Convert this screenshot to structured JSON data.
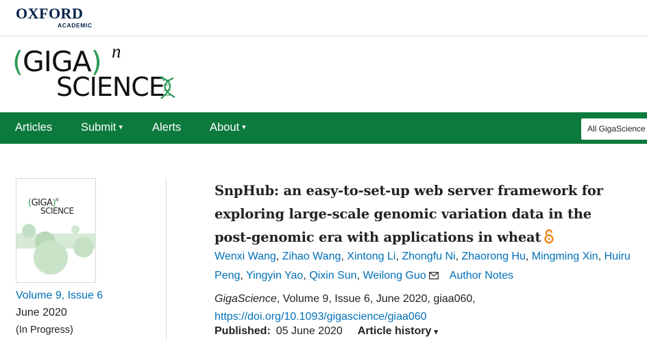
{
  "publisher": {
    "name": "OXFORD",
    "sub": "ACADEMIC"
  },
  "journal_logo": {
    "open_paren": "(",
    "giga": "GIGA",
    "close_paren": ")",
    "sup": "n",
    "science": "SCIENCE"
  },
  "nav": {
    "items": [
      {
        "label": "Articles",
        "has_caret": false
      },
      {
        "label": "Submit",
        "has_caret": true
      },
      {
        "label": "Alerts",
        "has_caret": false
      },
      {
        "label": "About",
        "has_caret": true
      }
    ],
    "caret": "▾",
    "search_scope": "All GigaScience"
  },
  "issue": {
    "volume_link": "Volume 9, Issue 6",
    "date": "June 2020",
    "status": "(In Progress)"
  },
  "article": {
    "title": "SnpHub: an easy-to-set-up web server framework for exploring large-scale genomic variation data in the post-genomic era with applications in wheat",
    "open_access_icon": "open-access-icon",
    "authors": [
      "Wenxi Wang",
      "Zihao Wang",
      "Xintong Li",
      "Zhongfu Ni",
      "Zhaorong Hu",
      "Mingming Xin",
      "Huiru Peng",
      "Yingyin Yao",
      "Qixin Sun",
      "Weilong Guo"
    ],
    "author_notes": "Author Notes",
    "citation": {
      "journal": "GigaScience",
      "rest": ", Volume 9, Issue 6, June 2020, giaa060, ",
      "doi": "https://doi.org/10.1093/gigascience/giaa060"
    },
    "published_label": "Published:",
    "published_date": "05 June 2020",
    "history_label": "Article history"
  },
  "colors": {
    "nav_green": "#0d7a3d",
    "link_blue": "#006fb7",
    "oxford_navy": "#002147",
    "oa_orange": "#f68212"
  }
}
